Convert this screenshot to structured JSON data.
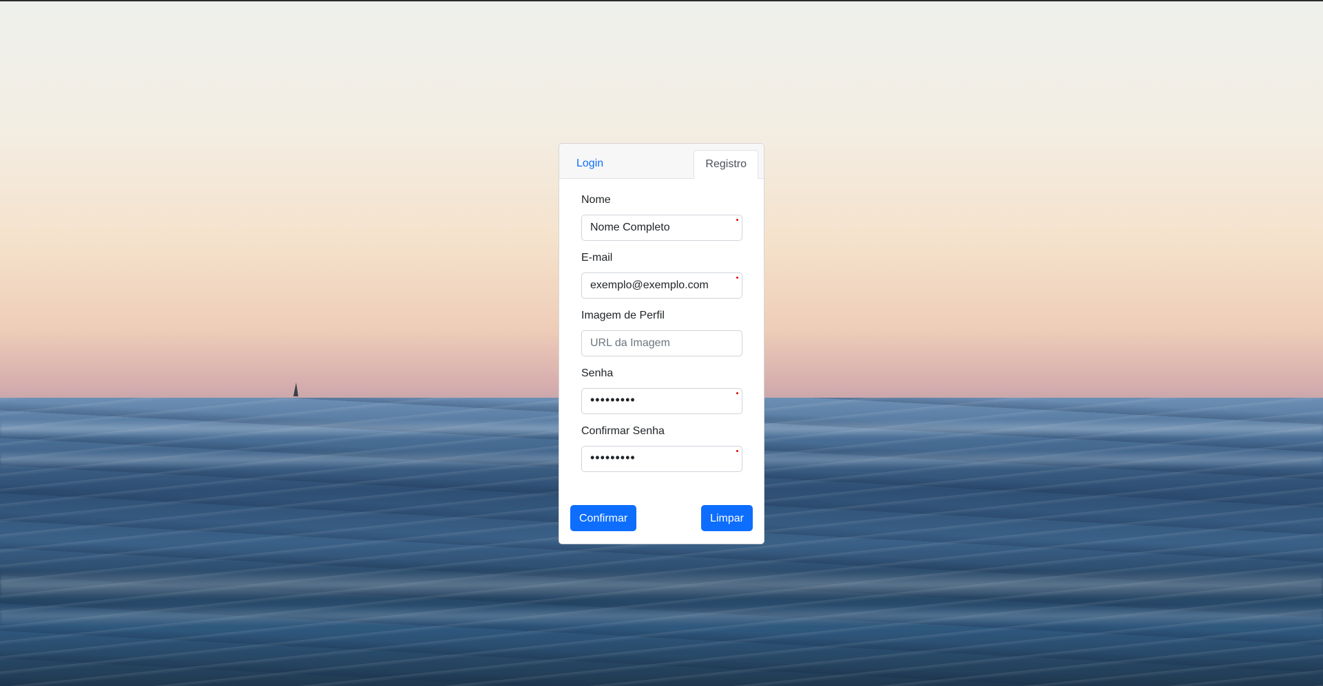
{
  "tabs": {
    "login": "Login",
    "registro": "Registro"
  },
  "form": {
    "nome": {
      "label": "Nome",
      "placeholder": "Nome Completo",
      "required": true
    },
    "email": {
      "label": "E-mail",
      "placeholder": "exemplo@exemplo.com",
      "required": true
    },
    "imagem": {
      "label": "Imagem de Perfil",
      "placeholder": "URL da Imagem",
      "required": false
    },
    "senha": {
      "label": "Senha",
      "placeholder": "•••••••••",
      "required": true
    },
    "confirmar": {
      "label": "Confirmar Senha",
      "placeholder": "•••••••••",
      "required": true
    }
  },
  "buttons": {
    "confirm": "Confirmar",
    "clear": "Limpar"
  },
  "colors": {
    "accent": "#0d6efd",
    "required_marker": "#e60000"
  }
}
